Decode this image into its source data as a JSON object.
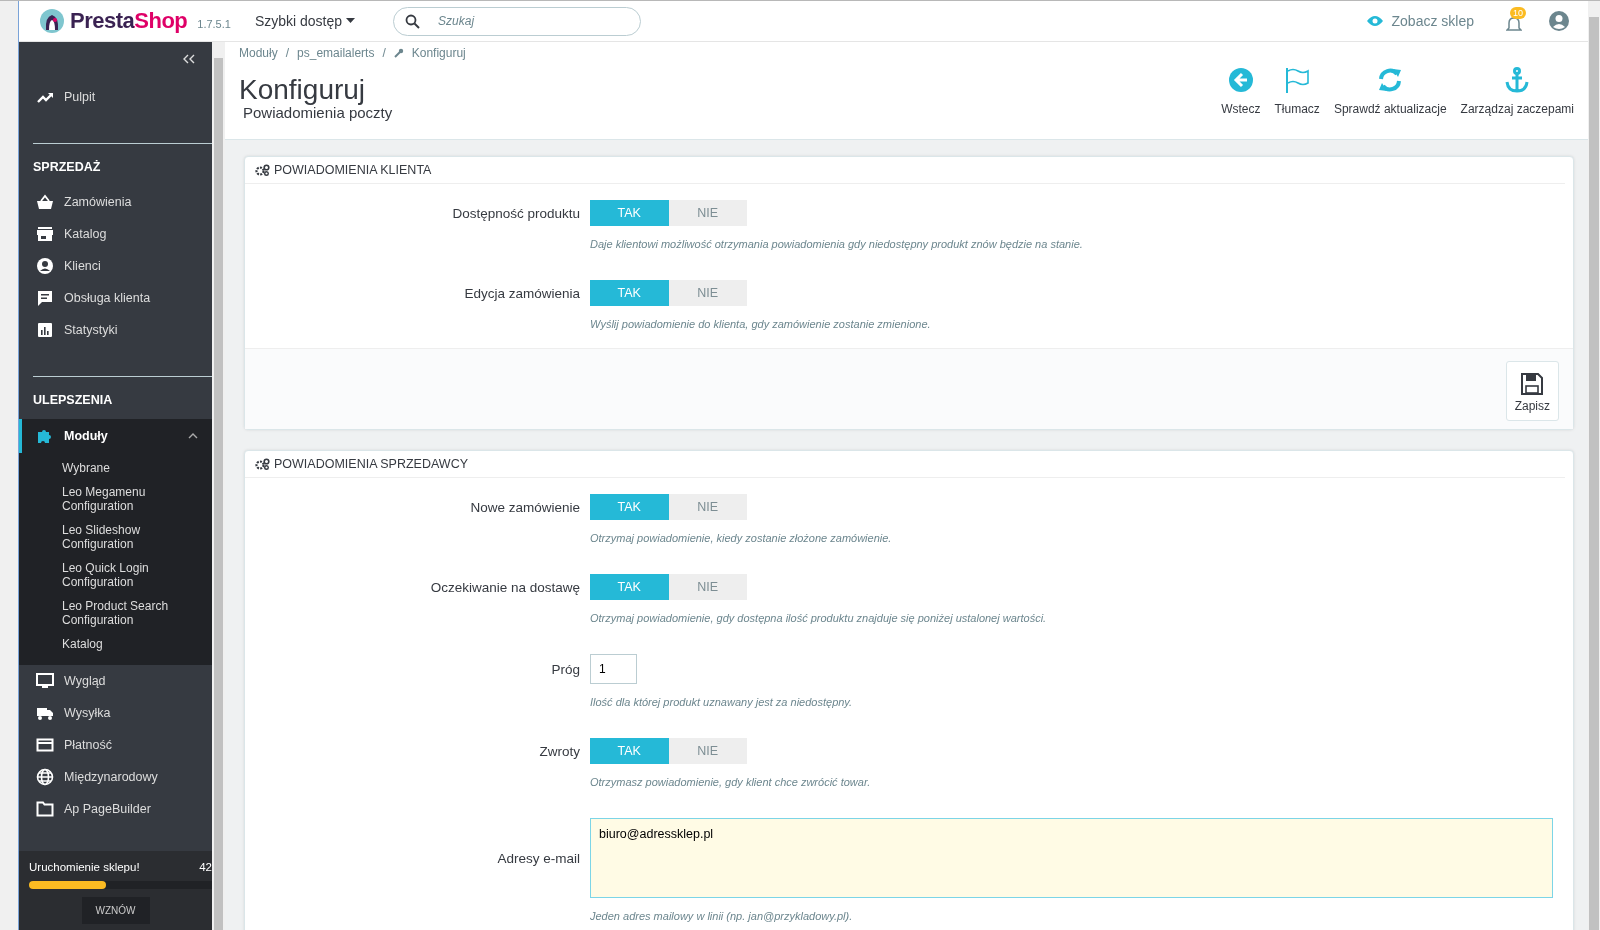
{
  "header": {
    "logo": "PrestaShop",
    "version": "1.7.5.1",
    "quick_access": "Szybki dostęp",
    "search": {
      "placeholder": "Szukaj"
    },
    "view_shop": "Zobacz sklep",
    "notifications": "10"
  },
  "sidebar": {
    "items": [
      {
        "label": "Pulpit",
        "selected": false
      }
    ],
    "sections": [
      {
        "title": "SPRZEDAŻ",
        "items": [
          {
            "label": "Zamówienia",
            "selected": false,
            "expanded": false
          },
          {
            "label": "Katalog",
            "selected": false,
            "expanded": false
          },
          {
            "label": "Klienci",
            "selected": false,
            "expanded": false
          },
          {
            "label": "Obsługa klienta",
            "selected": false,
            "expanded": false
          },
          {
            "label": "Statystyki",
            "selected": false,
            "expanded": false
          }
        ]
      },
      {
        "title": "ULEPSZENIA",
        "items": [
          {
            "label": "Moduły",
            "selected": true,
            "expanded": true,
            "children": [
              {
                "label": "Wybrane",
                "selected": false
              },
              {
                "label": "Leo Megamenu Configuration",
                "selected": false
              },
              {
                "label": "Leo Slideshow Configuration",
                "selected": false
              },
              {
                "label": "Leo Quick Login Configuration",
                "selected": false
              },
              {
                "label": "Leo Product Search Configuration",
                "selected": false
              },
              {
                "label": "Katalog",
                "selected": false
              }
            ]
          },
          {
            "label": "Wygląd",
            "selected": false,
            "expanded": false
          },
          {
            "label": "Wysyłka",
            "selected": false,
            "expanded": false
          },
          {
            "label": "Płatność",
            "selected": false,
            "expanded": false
          },
          {
            "label": "Międzynarodowy",
            "selected": false,
            "expanded": false
          },
          {
            "label": "Ap PageBuilder",
            "selected": false,
            "expanded": false
          }
        ]
      }
    ],
    "onboarding": {
      "label": "Uruchomienie sklepu!",
      "percent": "42",
      "level": 0.42,
      "button": "WZNÓW"
    }
  },
  "breadcrumb": {
    "links": [
      "Moduły",
      "ps_emailalerts",
      "Konfiguruj"
    ],
    "separators": [
      "/",
      "/"
    ]
  },
  "page_title": "Konfiguruj",
  "page_subtitle": "Powiadomienia poczty",
  "toolbar": [
    "Wstecz",
    "Tłumacz",
    "Sprawdź aktualizacje",
    "Zarządzaj zaczepami"
  ],
  "panels": [
    {
      "title": "POWIADOMIENIA KLIENTA",
      "save": "Zapisz",
      "fields": [
        {
          "kind": "switch",
          "label": "Dostępność produktu",
          "options": [
            {
              "label": "TAK",
              "selected": true
            },
            {
              "label": "NIE",
              "selected": false
            }
          ],
          "help": "Daje klientowi możliwość otrzymania powiadomienia gdy niedostępny produkt znów będzie na stanie."
        },
        {
          "kind": "switch",
          "label": "Edycja zamówienia",
          "options": [
            {
              "label": "TAK",
              "selected": true
            },
            {
              "label": "NIE",
              "selected": false
            }
          ],
          "help": "Wyślij powiadomienie do klienta, gdy zamówienie zostanie zmienione."
        }
      ]
    },
    {
      "title": "POWIADOMIENIA SPRZEDAWCY",
      "fields": [
        {
          "kind": "switch",
          "label": "Nowe zamówienie",
          "options": [
            {
              "label": "TAK",
              "selected": true
            },
            {
              "label": "NIE",
              "selected": false
            }
          ],
          "help": "Otrzymaj powiadomienie, kiedy zostanie złożone zamówienie."
        },
        {
          "kind": "switch",
          "label": "Oczekiwanie na dostawę",
          "options": [
            {
              "label": "TAK",
              "selected": true
            },
            {
              "label": "NIE",
              "selected": false
            }
          ],
          "help": "Otrzymaj powiadomienie, gdy dostępna ilość produktu znajduje się poniżej ustalonej wartości."
        },
        {
          "kind": "number",
          "label": "Próg",
          "value": "1",
          "help": "Ilość dla której produkt uznawany jest za niedostępny."
        },
        {
          "kind": "switch",
          "label": "Zwroty",
          "options": [
            {
              "label": "TAK",
              "selected": true
            },
            {
              "label": "NIE",
              "selected": false
            }
          ],
          "help": "Otrzymasz powiadomienie, gdy klient chce zwrócić towar."
        },
        {
          "kind": "textarea",
          "label": "Adresy e-mail",
          "value": "biuro@adressklep.pl",
          "help": "Jeden adres mailowy w linii (np. jan@przykladowy.pl)."
        }
      ]
    }
  ]
}
